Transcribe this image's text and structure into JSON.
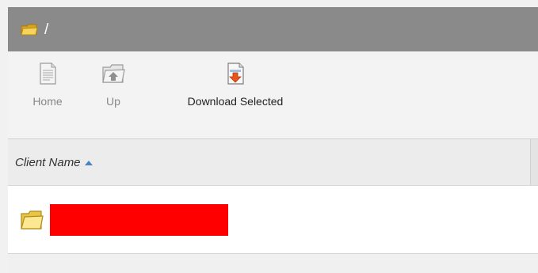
{
  "titlebar": {
    "path": "/"
  },
  "toolbar": {
    "home_label": "Home",
    "up_label": "Up",
    "download_label": "Download Selected"
  },
  "grid": {
    "column_header": "Client Name",
    "sort": "ascending",
    "rows": [
      {
        "name": "",
        "redacted": true
      }
    ]
  },
  "colors": {
    "titlebar_bg": "#8a8a8a",
    "sort_arrow": "#4a84c4",
    "redaction": "#ff0000"
  },
  "icons": {
    "titlebar": "folder-icon",
    "home": "document-icon",
    "up": "folder-up-icon",
    "download": "download-file-icon",
    "row": "folder-icon"
  }
}
